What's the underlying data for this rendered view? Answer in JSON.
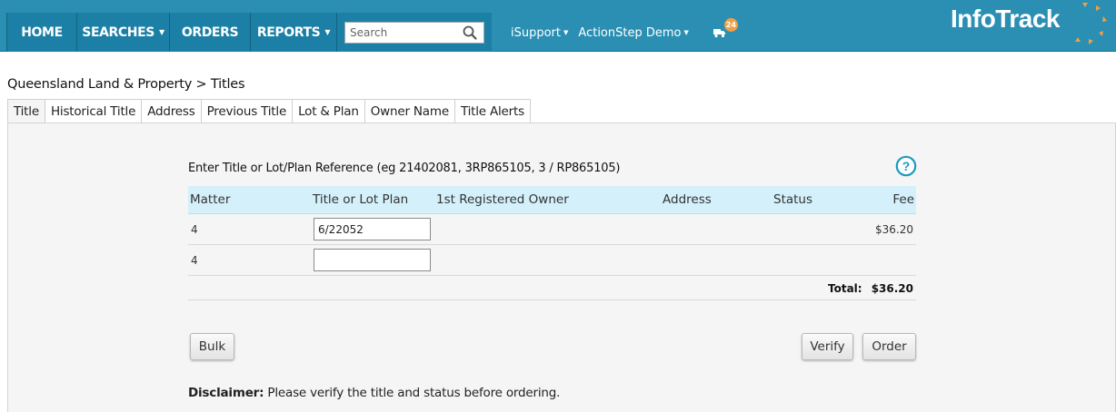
{
  "nav": {
    "home": "HOME",
    "searches": "SEARCHES",
    "orders": "ORDERS",
    "reports": "REPORTS",
    "search_placeholder": "Search",
    "isupport": "iSupport",
    "account": "ActionStep Demo",
    "notification_count": "24",
    "logo": "InfoTrack",
    "brand_color": "#2a8fb2",
    "accent_color": "#f0a047"
  },
  "breadcrumb": "Queensland Land & Property > Titles",
  "tabs": [
    "Title",
    "Historical Title",
    "Address",
    "Previous Title",
    "Lot & Plan",
    "Owner Name",
    "Title Alerts"
  ],
  "form": {
    "instruction": "Enter Title or Lot/Plan Reference (eg 21402081, 3RP865105, 3 / RP865105)",
    "columns": {
      "matter": "Matter",
      "title": "Title or Lot Plan",
      "owner": "1st Registered Owner",
      "address": "Address",
      "status": "Status",
      "fee": "Fee"
    },
    "rows": [
      {
        "matter": "4",
        "title": "6/22052",
        "owner": "",
        "address": "",
        "status": "",
        "fee": "$36.20"
      },
      {
        "matter": "4",
        "title": "",
        "owner": "",
        "address": "",
        "status": "",
        "fee": ""
      }
    ],
    "total_label": "Total:",
    "total_value": "$36.20"
  },
  "buttons": {
    "bulk": "Bulk",
    "verify": "Verify",
    "order": "Order"
  },
  "disclaimer": {
    "label": "Disclaimer:",
    "text": " Please verify the title and status before ordering."
  }
}
